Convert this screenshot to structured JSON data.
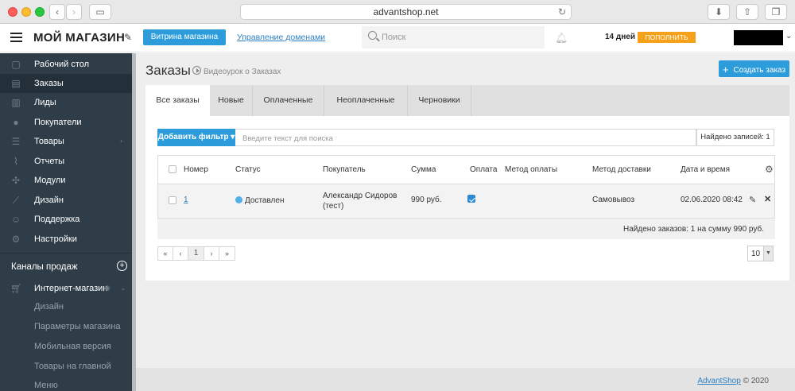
{
  "browser": {
    "url": "advantshop.net",
    "back_icon": "chevron-left-icon",
    "forward_icon": "chevron-right-icon",
    "sidebar_icon": "sidebar-toggle-icon",
    "reload_icon": "reload-icon",
    "download_icon": "download-icon",
    "share_icon": "share-icon",
    "tabs_icon": "tabs-icon"
  },
  "header": {
    "title": "МОЙ МАГАЗИН",
    "storefront_button": "Витрина магазина",
    "domains_link": "Управление доменами",
    "search_placeholder": "Поиск",
    "trial_days": "14 дней",
    "topup_button": "ПОПОЛНИТЬ"
  },
  "sidebar": {
    "items": [
      {
        "label": "Рабочий стол",
        "icon": "desktop-icon"
      },
      {
        "label": "Заказы",
        "icon": "orders-icon"
      },
      {
        "label": "Лиды",
        "icon": "leads-icon"
      },
      {
        "label": "Покупатели",
        "icon": "customers-icon"
      },
      {
        "label": "Товары",
        "icon": "products-icon"
      },
      {
        "label": "Отчеты",
        "icon": "reports-icon"
      },
      {
        "label": "Модули",
        "icon": "modules-icon"
      },
      {
        "label": "Дизайн",
        "icon": "design-icon"
      },
      {
        "label": "Поддержка",
        "icon": "support-icon"
      },
      {
        "label": "Настройки",
        "icon": "settings-icon"
      }
    ],
    "channels_title": "Каналы продаж",
    "channel": "Интернет-магазин",
    "sub_items": [
      "Дизайн",
      "Параметры магазина",
      "Мобильная версия",
      "Товары на главной",
      "Меню"
    ]
  },
  "main": {
    "title": "Заказы",
    "video_link": "Видеоурок о Заказах",
    "create_button": "Создать заказ",
    "tabs": [
      "Все заказы",
      "Новые",
      "Оплаченные",
      "Неоплаченные",
      "Черновики"
    ],
    "filter_button": "Добавить фильтр",
    "search_placeholder": "Введите текст для поиска",
    "records_found": "Найдено записей: 1",
    "columns": [
      "Номер",
      "Статус",
      "Покупатель",
      "Сумма",
      "Оплата",
      "Метод оплаты",
      "Метод доставки",
      "Дата и время"
    ],
    "rows": [
      {
        "number": "1",
        "status": "Доставлен",
        "customer_line1": "Александр Сидоров",
        "customer_line2": "(тест)",
        "sum": "990 руб.",
        "paid": true,
        "payment_method": "",
        "delivery_method": "Самовывоз",
        "datetime": "02.06.2020 08:42"
      }
    ],
    "summary": "Найдено заказов: 1 на сумму 990 руб.",
    "pager": [
      "«",
      "‹",
      "1",
      "›",
      "»"
    ],
    "page_size": "10"
  },
  "footer": {
    "link": "AdvantShop",
    "copyright": "© 2020"
  },
  "colors": {
    "accent": "#2d9cdb",
    "sidebar_bg": "#2f3d48",
    "topup": "#f6a11a",
    "status_delivered": "#4fb0e8"
  }
}
